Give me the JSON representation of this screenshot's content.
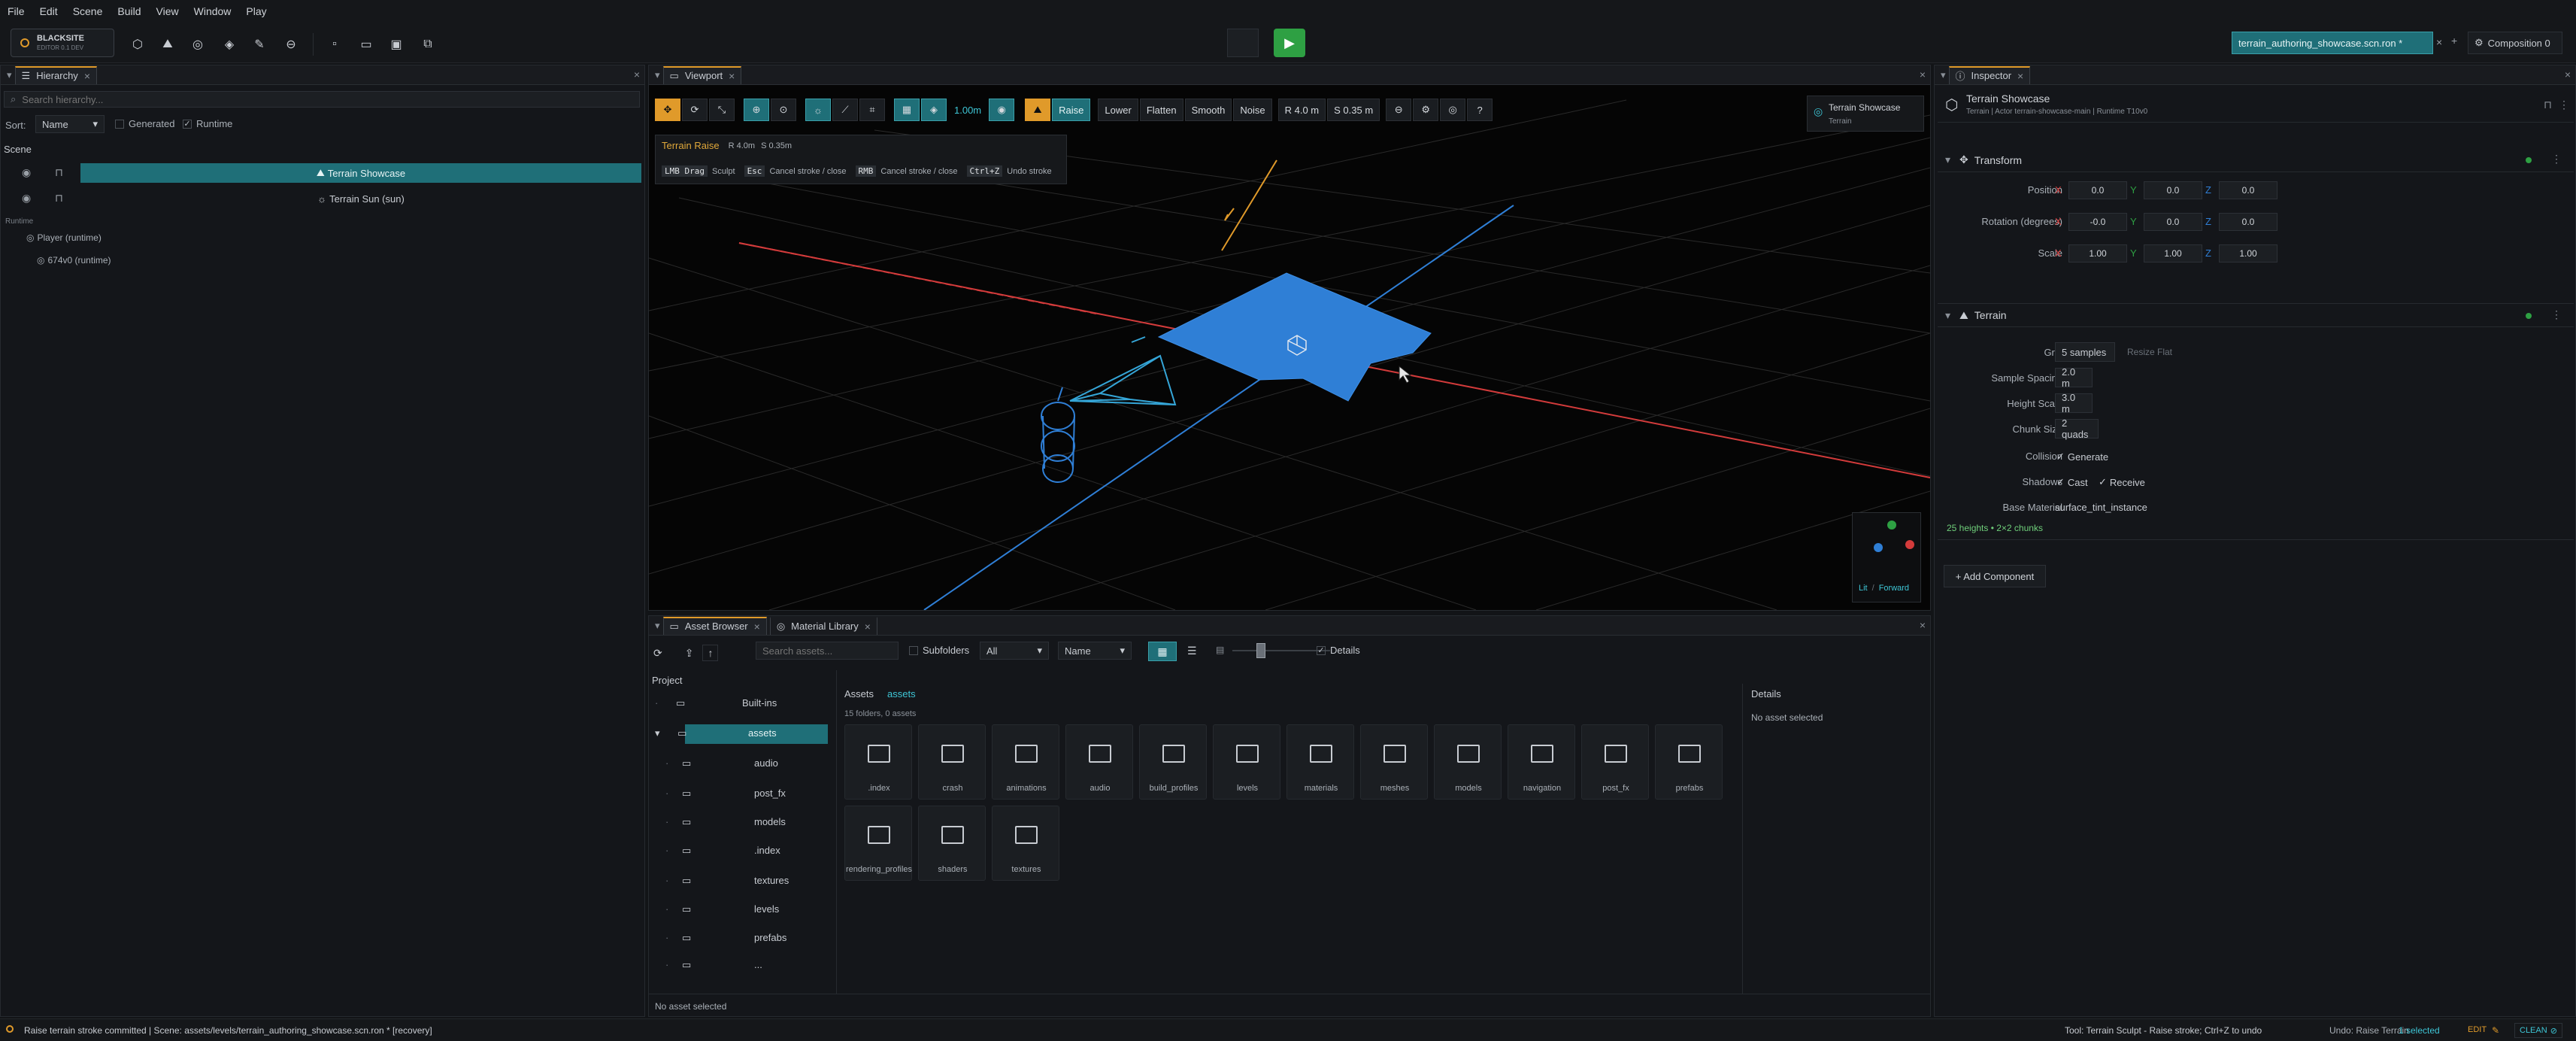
{
  "menu": [
    "File",
    "Edit",
    "Scene",
    "Build",
    "View",
    "Window",
    "Play"
  ],
  "brand": {
    "name": "BLACKSITE",
    "sub": "EDITOR 0.1 DEV"
  },
  "scene_tab": {
    "name": "terrain_authoring_showcase.scn.ron *",
    "composition": "Composition 0"
  },
  "hierarchy": {
    "title": "Hierarchy",
    "search_placeholder": "Search hierarchy...",
    "sort_label": "Sort:",
    "sort_value": "Name",
    "generated": "Generated",
    "runtime_check": "Runtime",
    "scene_header": "Scene",
    "items": [
      "Terrain Showcase",
      "Terrain Sun  (sun)"
    ],
    "runtime_header": "Runtime",
    "runtime_items": [
      "Player  (runtime)",
      "674v0  (runtime)"
    ]
  },
  "viewport": {
    "title": "Viewport",
    "snap_value": "1.00m",
    "modes": [
      "Raise",
      "Lower",
      "Flatten",
      "Smooth",
      "Noise"
    ],
    "radius": "R 4.0 m",
    "strength": "S 0.35 m",
    "overlay": {
      "tool": "Terrain Raise",
      "r": "R 4.0m",
      "s": "S 0.35m",
      "hints": [
        [
          "LMB Drag",
          "Sculpt"
        ],
        [
          "Esc",
          "Cancel stroke / close"
        ],
        [
          "RMB",
          "Cancel stroke / close"
        ],
        [
          "Ctrl+Z",
          "Undo stroke"
        ]
      ]
    },
    "selection": {
      "name": "Terrain Showcase",
      "type": "Terrain"
    },
    "gizmo_lit": "Lit",
    "gizmo_sep": "/",
    "gizmo_view": "Forward"
  },
  "assets": {
    "tabs": [
      "Asset Browser",
      "Material Library"
    ],
    "search_placeholder": "Search assets...",
    "subfolders": "Subfolders",
    "filter": "All",
    "sort": "Name",
    "details_check": "Details",
    "project_label": "Project",
    "tree": [
      "Built-ins",
      "assets",
      "audio",
      "post_fx",
      "models",
      ".index",
      "textures",
      "levels",
      "prefabs",
      "..."
    ],
    "crumb_root": "Assets",
    "crumb_cur": "assets",
    "count": "15 folders, 0 assets",
    "folders": [
      ".index",
      "crash",
      "animations",
      "audio",
      "build_profiles",
      "levels",
      "materials",
      "meshes",
      "models",
      "navigation",
      "post_fx",
      "prefabs",
      "rendering_profiles",
      "shaders",
      "textures"
    ],
    "details_title": "Details",
    "details_body": "No asset selected",
    "footer": "No asset selected"
  },
  "inspector": {
    "title": "Inspector",
    "entity": "Terrain Showcase",
    "entity_sub": "Terrain  |  Actor terrain-showcase-main  |  Runtime T10v0",
    "transform": "Transform",
    "rows": [
      {
        "label": "Position",
        "x": "0.0",
        "y": "0.0",
        "z": "0.0"
      },
      {
        "label": "Rotation (degrees)",
        "x": "-0.0",
        "y": "0.0",
        "z": "0.0"
      },
      {
        "label": "Scale",
        "x": "1.00",
        "y": "1.00",
        "z": "1.00"
      }
    ],
    "terrain": "Terrain",
    "grid_label": "Grid",
    "grid_val": "5 samples",
    "resize": "Resize Flat",
    "spacing_label": "Sample Spacing",
    "spacing_val": "2.0 m",
    "height_label": "Height Scale",
    "height_val": "3.0 m",
    "chunk_label": "Chunk Size",
    "chunk_val": "2 quads",
    "collision_label": "Collision",
    "collision_val": "Generate",
    "shadows_label": "Shadows",
    "cast": "Cast",
    "receive": "Receive",
    "material_label": "Base Material",
    "material_val": "surface_tint_instance",
    "summary": "25 heights • 2×2 chunks",
    "add_component": "+ Add Component"
  },
  "status": {
    "left": "Raise terrain stroke committed  |  Scene: assets/levels/terrain_authoring_showcase.scn.ron * [recovery]",
    "right": "Tool: Terrain Sculpt - Raise stroke; Ctrl+Z to undo",
    "undo": "Undo: Raise Terrain",
    "selected": "1 selected",
    "mode": "EDIT",
    "clean": "CLEAN"
  },
  "colors": {
    "accent": "#e09a2a",
    "teal": "#1f6f78",
    "play": "#2ea043",
    "terrain": "#2f7fd6"
  }
}
